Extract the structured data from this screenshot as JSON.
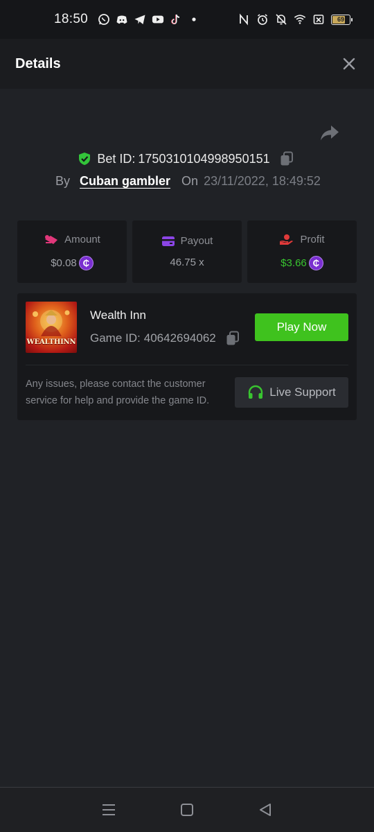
{
  "status_bar": {
    "time": "18:50",
    "battery_level": "69",
    "battery_fraction": 0.69,
    "left_icons": [
      "whatsapp-icon",
      "discord-icon",
      "telegram-icon",
      "youtube-icon",
      "tiktok-icon",
      "dot-icon"
    ],
    "right_icons": [
      "nfc-icon",
      "alarm-icon",
      "mute-icon",
      "wifi-icon",
      "sim-off-icon",
      "battery-icon"
    ]
  },
  "header": {
    "title": "Details",
    "close_icon": "close-icon"
  },
  "bet": {
    "id_label": "Bet ID:",
    "id_value": "1750310104998950151",
    "by_label": "By",
    "username": "Cuban gambler",
    "on_label": "On",
    "datetime": "23/11/2022, 18:49:52"
  },
  "stats": {
    "amount": {
      "label": "Amount",
      "value": "$0.08",
      "icon": "amount-icon"
    },
    "payout": {
      "label": "Payout",
      "value": "46.75 x",
      "icon": "wallet-icon"
    },
    "profit": {
      "label": "Profit",
      "value": "$3.66",
      "icon": "profit-icon"
    },
    "coin_symbol": "₵"
  },
  "game": {
    "name": "Wealth Inn",
    "id_label": "Game ID:",
    "id_value": "40642694062",
    "thumb_logo": "WEALTHINN",
    "play_label": "Play Now",
    "issue_text": "Any issues, please contact the customer service for help and provide the game ID.",
    "support_label": "Live Support"
  },
  "colors": {
    "background": "#202226",
    "accent_green": "#3fc21e",
    "profit_green": "#39c430",
    "coin_purple": "#7a2fd0"
  }
}
